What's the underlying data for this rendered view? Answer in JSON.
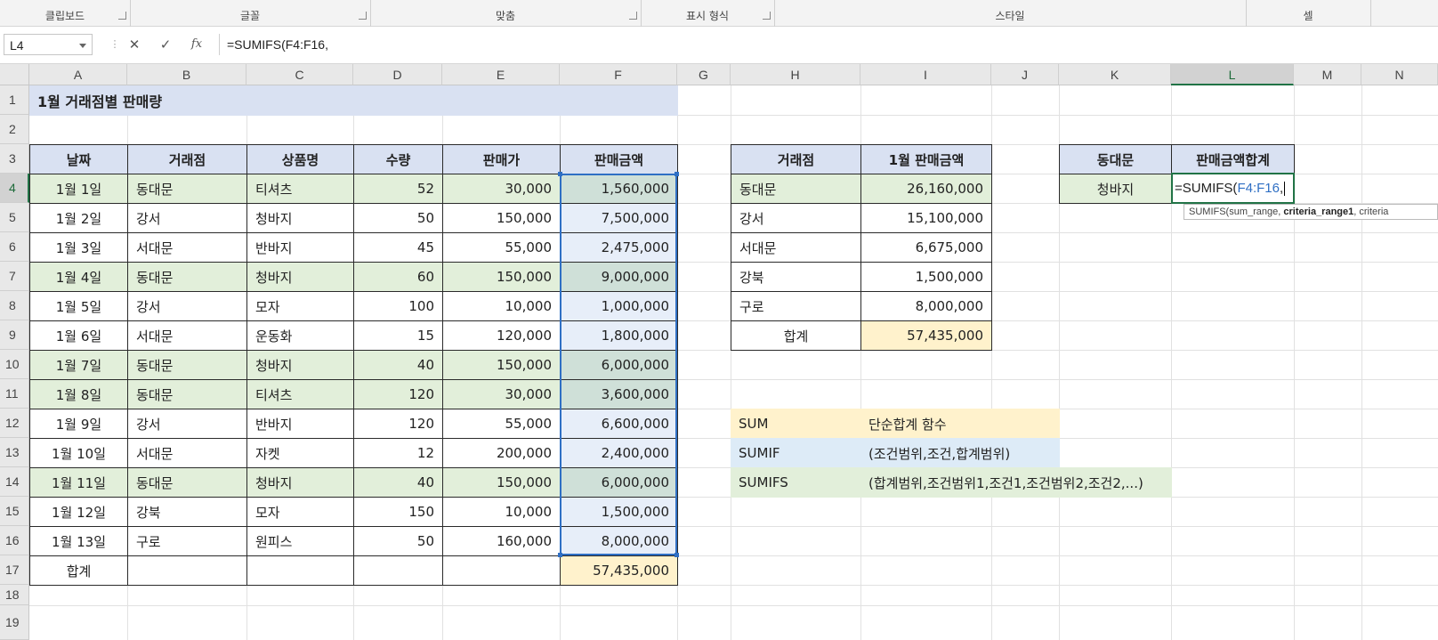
{
  "ribbon": {
    "groups": [
      "클립보드",
      "글꼴",
      "맞춤",
      "표시 형식",
      "",
      "스타일",
      "셀"
    ]
  },
  "formula_bar": {
    "name_box": "L4",
    "formula_prefix": "=SUMIFS(",
    "formula_ref": "F4:F16",
    "formula_suffix": ",",
    "cancel_icon": "close-icon",
    "enter_icon": "check-icon",
    "fx_label": "fx"
  },
  "columns": [
    "A",
    "B",
    "C",
    "D",
    "E",
    "F",
    "G",
    "H",
    "I",
    "J",
    "K",
    "L",
    "M",
    "N"
  ],
  "selected_column": "L",
  "rows": [
    "1",
    "2",
    "3",
    "4",
    "5",
    "6",
    "7",
    "8",
    "9",
    "10",
    "11",
    "12",
    "13",
    "14",
    "15",
    "16",
    "17",
    "18",
    "19"
  ],
  "selected_row": "4",
  "sheet": {
    "title": "1월 거래점별 판매량",
    "headers": [
      "날짜",
      "거래점",
      "상품명",
      "수량",
      "판매가",
      "판매금액"
    ],
    "records": [
      [
        "1월 1일",
        "동대문",
        "티셔츠",
        "52",
        "30,000",
        "1,560,000"
      ],
      [
        "1월 2일",
        "강서",
        "청바지",
        "50",
        "150,000",
        "7,500,000"
      ],
      [
        "1월 3일",
        "서대문",
        "반바지",
        "45",
        "55,000",
        "2,475,000"
      ],
      [
        "1월 4일",
        "동대문",
        "청바지",
        "60",
        "150,000",
        "9,000,000"
      ],
      [
        "1월 5일",
        "강서",
        "모자",
        "100",
        "10,000",
        "1,000,000"
      ],
      [
        "1월 6일",
        "서대문",
        "운동화",
        "15",
        "120,000",
        "1,800,000"
      ],
      [
        "1월 7일",
        "동대문",
        "청바지",
        "40",
        "150,000",
        "6,000,000"
      ],
      [
        "1월 8일",
        "동대문",
        "티셔츠",
        "120",
        "30,000",
        "3,600,000"
      ],
      [
        "1월 9일",
        "강서",
        "반바지",
        "120",
        "55,000",
        "6,600,000"
      ],
      [
        "1월 10일",
        "서대문",
        "자켓",
        "12",
        "200,000",
        "2,400,000"
      ],
      [
        "1월 11일",
        "동대문",
        "청바지",
        "40",
        "150,000",
        "6,000,000"
      ],
      [
        "1월 12일",
        "강북",
        "모자",
        "150",
        "10,000",
        "1,500,000"
      ],
      [
        "1월 13일",
        "구로",
        "원피스",
        "50",
        "160,000",
        "8,000,000"
      ]
    ],
    "total_label": "합계",
    "total_value": "57,435,000"
  },
  "summary": {
    "headers": [
      "거래점",
      "1월 판매금액"
    ],
    "records": [
      [
        "동대문",
        "26,160,000"
      ],
      [
        "강서",
        "15,100,000"
      ],
      [
        "서대문",
        "6,675,000"
      ],
      [
        "강북",
        "1,500,000"
      ],
      [
        "구로",
        "8,000,000"
      ]
    ],
    "total_label": "합계",
    "total_value": "57,435,000"
  },
  "criteria": {
    "headers": [
      "동대문",
      "판매금액합계"
    ],
    "value": "청바지"
  },
  "notes": [
    {
      "name": "SUM",
      "desc": "단순합계 함수"
    },
    {
      "name": "SUMIF",
      "desc": "(조건범위,조건,합계범위)"
    },
    {
      "name": "SUMIFS",
      "desc": "(합계범위,조건범위1,조건1,조건범위2,조건2,...)"
    }
  ],
  "tooltip": {
    "pre": "SUMIFS(sum_range, ",
    "bold": "criteria_range1",
    "post": ", criteria"
  }
}
